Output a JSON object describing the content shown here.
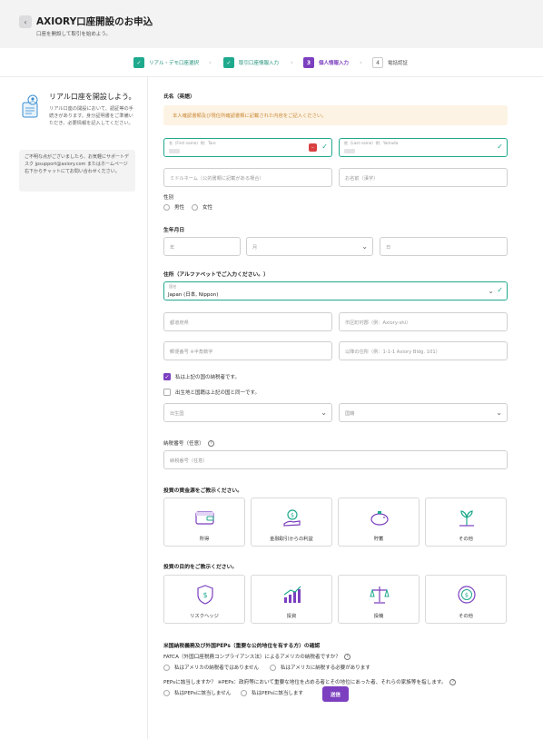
{
  "header": {
    "title": "AXIORY口座開設のお申込",
    "subtitle": "口座を開設して取引を始めよう。"
  },
  "steps": [
    {
      "num": "✓",
      "label": "リアル・デモ口座選択",
      "state": "done"
    },
    {
      "num": "✓",
      "label": "取引口座情報入力",
      "state": "done"
    },
    {
      "num": "3",
      "label": "個人情報入力",
      "state": "active"
    },
    {
      "num": "4",
      "label": "電話認証",
      "state": "todo"
    }
  ],
  "sidebar": {
    "heading": "リアル口座を開設しよう。",
    "text": "リアル口座の開設において、認証等の手続きがあります。身分証明書をご準備いただき、必要情報を記入してください。",
    "help_text": "ご不明な点がございましたら、お気軽にサポートデスク jpsupport@axiory.com またはホームページ右下からチャットにてお問い合わせください。"
  },
  "name_section": {
    "label": "氏名（英語）",
    "notice": "本人確認書類及び現住所確認書類に記載された内容をご記入ください。",
    "first_name_label": "名（First name）例：Taro",
    "last_name_label": "姓（Last name）例：Yamada",
    "middle_name_placeholder": "ミドルネーム（公的書類に記載がある場合）",
    "kanji_name_placeholder": "お名前（漢字）"
  },
  "gender": {
    "label": "性別",
    "options": [
      "男性",
      "女性"
    ]
  },
  "birthdate": {
    "label": "生年月日",
    "year_placeholder": "年",
    "month_placeholder": "月",
    "day_placeholder": "日"
  },
  "address": {
    "label": "住所（アルファベットでご入力ください。）",
    "country_label": "国名",
    "country_value": "Japan (日本, Nippon)",
    "prefecture_placeholder": "都道府県",
    "city_placeholder": "市区町村郡（例：Axiory-shi）",
    "postal_placeholder": "郵便番号 ※半角数字",
    "street_placeholder": "以降の住所（例：1-1-1 Axiory Bldg. 101）"
  },
  "tax": {
    "taxpayer_checkbox": "私は上記の国の納税者です。",
    "birthplace_checkbox": "出生地と国籍は上記の国と同一です。",
    "birth_country_placeholder": "出生国",
    "nationality_placeholder": "国籍",
    "tin_label": "納税番号（任意）",
    "tin_placeholder": "納税番号（任意）"
  },
  "funds": {
    "label": "投資の資金源をご教示ください。",
    "options": [
      "所得",
      "金融取引からの利益",
      "貯蓄",
      "その他"
    ]
  },
  "purpose": {
    "label": "投資の目的をご教示ください。",
    "options": [
      "リスクヘッジ",
      "投資",
      "投機",
      "その他"
    ]
  },
  "us_peps": {
    "label": "米国納税義務及び外国PEPs（重要な公的地位を有する方）の確認",
    "fatca_question": "FATCA（外国口座税務コンプライアンス法）によるアメリカの納税者ですか？",
    "fatca_options": [
      "私はアメリカの納税者ではありません",
      "私はアメリカに納税する必要があります"
    ],
    "peps_question": "PEPsに該当しますか？ ※PEPs：政府等において重要な地位を占める者とその地位にあった者、それらの家族等を指します。",
    "peps_options": [
      "私はPEPsに該当しません",
      "私はPEPsに該当します"
    ]
  },
  "submit_label": "送信",
  "colors": {
    "accent_purple": "#7b3fbf",
    "success_green": "#1fa98d",
    "notice_bg": "#fdf3e4",
    "notice_text": "#c98633"
  }
}
